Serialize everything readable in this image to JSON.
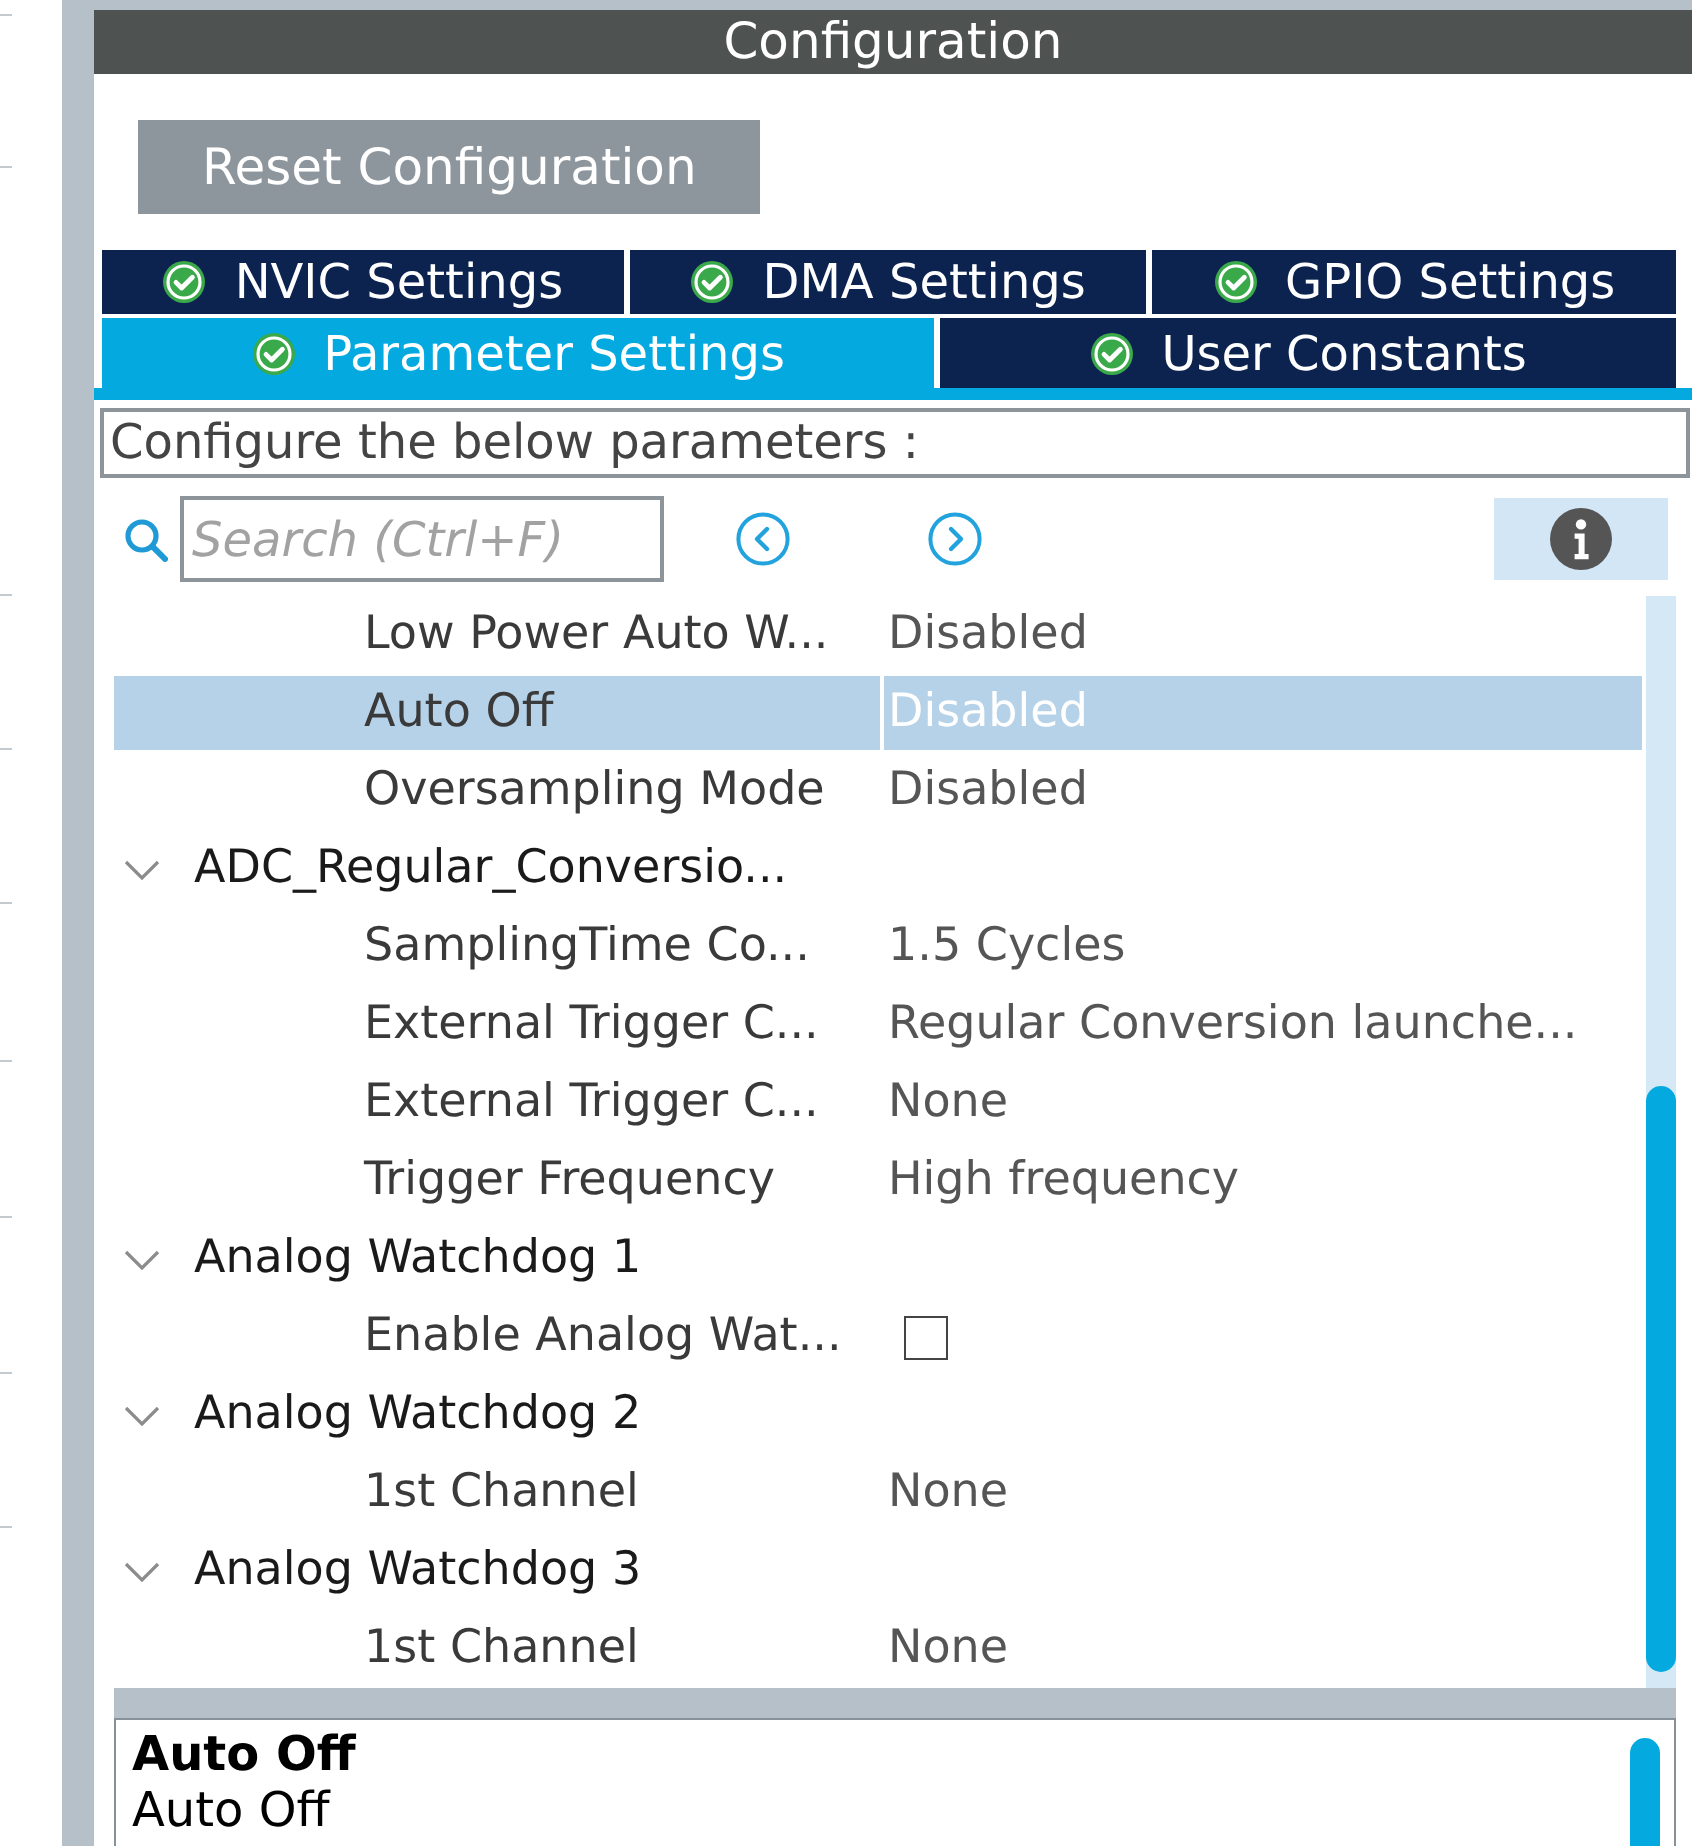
{
  "header": {
    "title": "Configuration"
  },
  "reset_button": {
    "label": "Reset Configuration"
  },
  "tab_rows": [
    {
      "tabs": [
        {
          "label": "NVIC Settings",
          "valid": true,
          "selected": false
        },
        {
          "label": "DMA Settings",
          "valid": true,
          "selected": false
        },
        {
          "label": "GPIO Settings",
          "valid": true,
          "selected": false
        }
      ]
    },
    {
      "tabs": [
        {
          "label": "Parameter Settings",
          "valid": true,
          "selected": true
        },
        {
          "label": "User Constants",
          "valid": true,
          "selected": false
        }
      ]
    }
  ],
  "instructions": {
    "text": "Configure the below parameters :"
  },
  "search": {
    "placeholder": "Search (Ctrl+F)"
  },
  "parameters": [
    {
      "kind": "group",
      "children": [
        {
          "kind": "value",
          "label": "Low Power Auto W...",
          "value": "Disabled",
          "selected": false
        },
        {
          "kind": "value",
          "label": "Auto Off",
          "value": "Disabled",
          "selected": true
        },
        {
          "kind": "value",
          "label": "Oversampling Mode",
          "value": "Disabled",
          "selected": false
        }
      ]
    },
    {
      "kind": "group",
      "label": "ADC_Regular_Conversio...",
      "expanded": true,
      "selected": false,
      "children": [
        {
          "kind": "value",
          "label": "SamplingTime Co...",
          "value": "1.5 Cycles",
          "selected": false
        },
        {
          "kind": "value",
          "label": "External Trigger C...",
          "value": "Regular Conversion launche...",
          "selected": false
        },
        {
          "kind": "value",
          "label": "External Trigger C...",
          "value": "None",
          "selected": false
        },
        {
          "kind": "value",
          "label": "Trigger Frequency",
          "value": "High frequency",
          "selected": false
        }
      ]
    },
    {
      "kind": "group",
      "label": "Analog Watchdog 1",
      "expanded": true,
      "selected": false,
      "children": [
        {
          "kind": "checkbox",
          "label": "Enable Analog Wat...",
          "checked": false,
          "selected": false
        }
      ]
    },
    {
      "kind": "group",
      "label": "Analog Watchdog 2",
      "expanded": true,
      "selected": false,
      "children": [
        {
          "kind": "value",
          "label": "1st Channel",
          "value": "None",
          "selected": false
        }
      ]
    },
    {
      "kind": "group",
      "label": "Analog Watchdog 3",
      "expanded": true,
      "selected": false,
      "children": [
        {
          "kind": "value",
          "label": "1st Channel",
          "value": "None",
          "selected": false
        }
      ]
    }
  ],
  "description": {
    "title": "Auto Off",
    "text": "Auto Off"
  }
}
